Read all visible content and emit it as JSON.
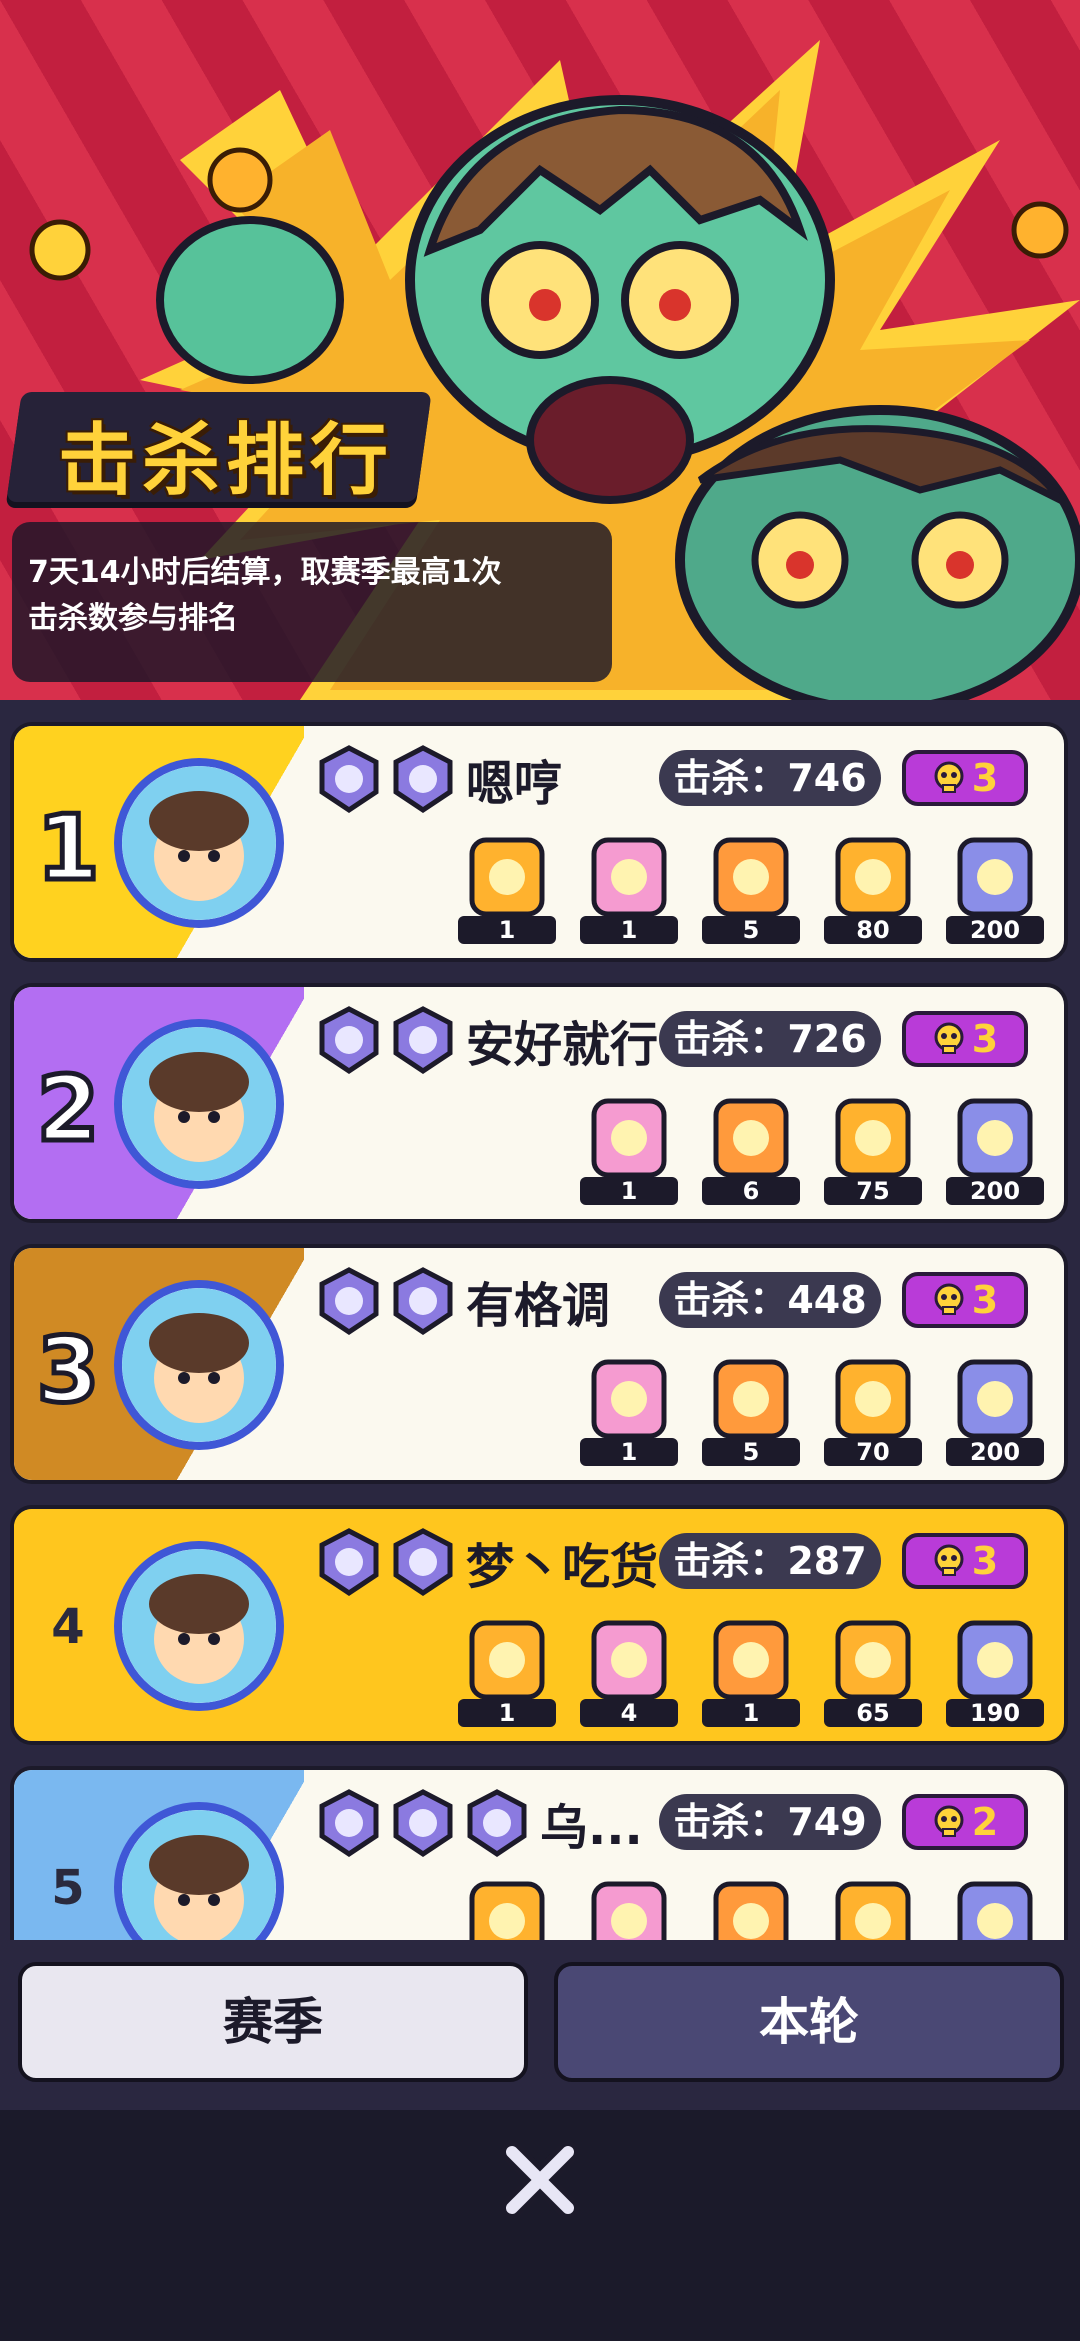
{
  "banner": {
    "title": "击杀排行",
    "description_line1": "7天14小时后结算，取赛季最高1次",
    "description_line2": "击杀数参与排名"
  },
  "players": [
    {
      "rank": "1",
      "name": "嗯哼",
      "kills_label": "击杀：746",
      "skull_count": "3",
      "stripe_color": "#ffd21f",
      "rewards": [
        "1",
        "1",
        "5",
        "80",
        "200"
      ]
    },
    {
      "rank": "2",
      "name": "安好就行",
      "kills_label": "击杀：726",
      "skull_count": "3",
      "stripe_color": "#b36ef2",
      "rewards": [
        "1",
        "6",
        "75",
        "200"
      ]
    },
    {
      "rank": "3",
      "name": "有格调",
      "kills_label": "击杀：448",
      "skull_count": "3",
      "stripe_color": "#d08a24",
      "rewards": [
        "1",
        "5",
        "70",
        "200"
      ]
    },
    {
      "rank": "4",
      "name": "梦丶吃货",
      "kills_label": "击杀：287",
      "skull_count": "3",
      "stripe_color": "#ffc61e",
      "rewards": [
        "1",
        "4",
        "1",
        "65",
        "190"
      ]
    },
    {
      "rank": "5",
      "name": "乌...",
      "kills_label": "击杀：749",
      "skull_count": "2",
      "stripe_color": "#7ab8f0",
      "rewards": [
        "",
        "",
        "",
        "",
        ""
      ]
    }
  ],
  "tabs": {
    "season": "赛季",
    "round": "本轮"
  },
  "icons": {
    "close": "close-icon",
    "skull": "skull-icon",
    "badge": "rank-badge-icon"
  },
  "colors": {
    "accent_gold": "#ffd23a",
    "banner_red": "#d8304c",
    "tab_active": "#e9e7f0",
    "tab_inactive": "#4a4874"
  }
}
